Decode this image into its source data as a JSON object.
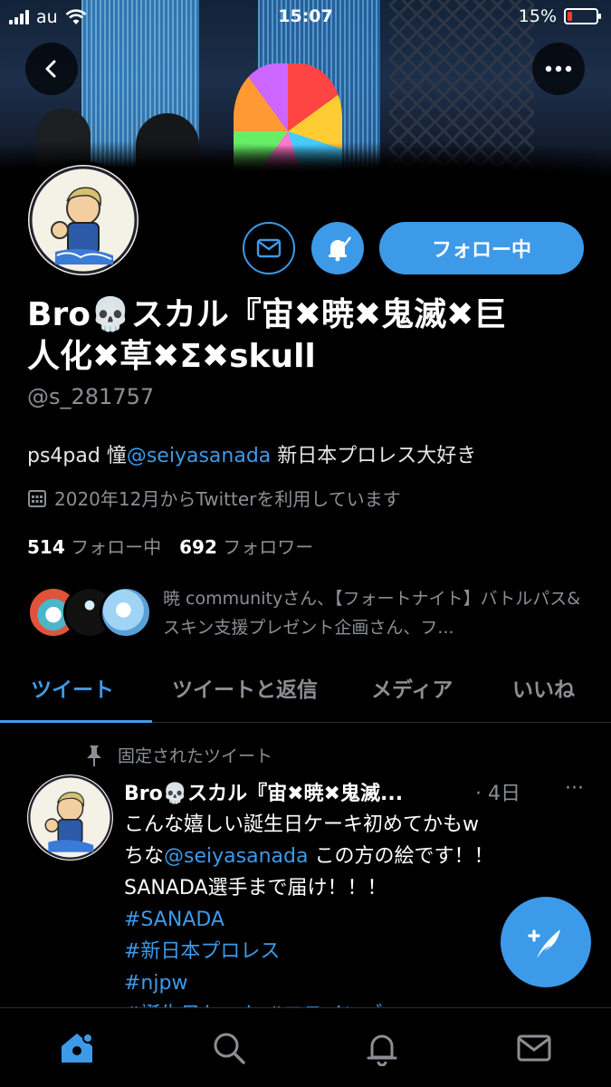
{
  "status_bar": {
    "carrier": "au",
    "time": "15:07",
    "battery": "15%",
    "battery_level": 0.15
  },
  "profile": {
    "name_line1": "Bro💀スカル『宙✖暁✖鬼滅✖巨",
    "name_line2": "人化✖草✖Σ✖skull",
    "handle": "@s_281757",
    "bio_prefix": "ps4pad 憧",
    "bio_mention": "@seiyasanada",
    "bio_suffix": " 新日本プロレス大好き",
    "joined": "2020年12月からTwitterを利用しています",
    "following_count": "514",
    "following_label": "フォロー中",
    "followers_count": "692",
    "followers_label": "フォロワー",
    "known_followers": "暁 communityさん、【フォートナイト】バトルパス&スキン支援プレゼント企画さん、フ..."
  },
  "actions": {
    "follow_label": "フォロー中"
  },
  "tabs": [
    {
      "label": "ツイート",
      "active": true
    },
    {
      "label": "ツイートと返信",
      "active": false
    },
    {
      "label": "メディア",
      "active": false
    },
    {
      "label": "いいね",
      "active": false
    }
  ],
  "tweet": {
    "pinned_label": "固定されたツイート",
    "author": "Bro💀スカル『宙✖暁✖鬼滅...",
    "time": "· 4日",
    "more": "···",
    "line1": "こんな嬉しい誕生日ケーキ初めてかもw",
    "line2_prefix": "ちな",
    "line2_mention": "@seiyasanada",
    "line2_suffix": " この方の絵です！！",
    "line3": "SANADA選手まで届け！！！",
    "hashtag1": "#SANADA",
    "hashtag2": "#新日本プロレス",
    "hashtag3": "#njpw",
    "hashtag4": "#誕生日ケーキ #ロスインゴ"
  },
  "colors": {
    "accent": "#3d9ae8",
    "muted": "#8b8f94",
    "background": "#000000"
  },
  "icons": {
    "back": "back-arrow-icon",
    "more": "more-dots-icon",
    "message": "envelope-icon",
    "notifications": "bell-icon",
    "compose": "compose-feather-icon",
    "nav": [
      "home-icon",
      "search-icon",
      "bell-icon",
      "envelope-icon"
    ]
  }
}
